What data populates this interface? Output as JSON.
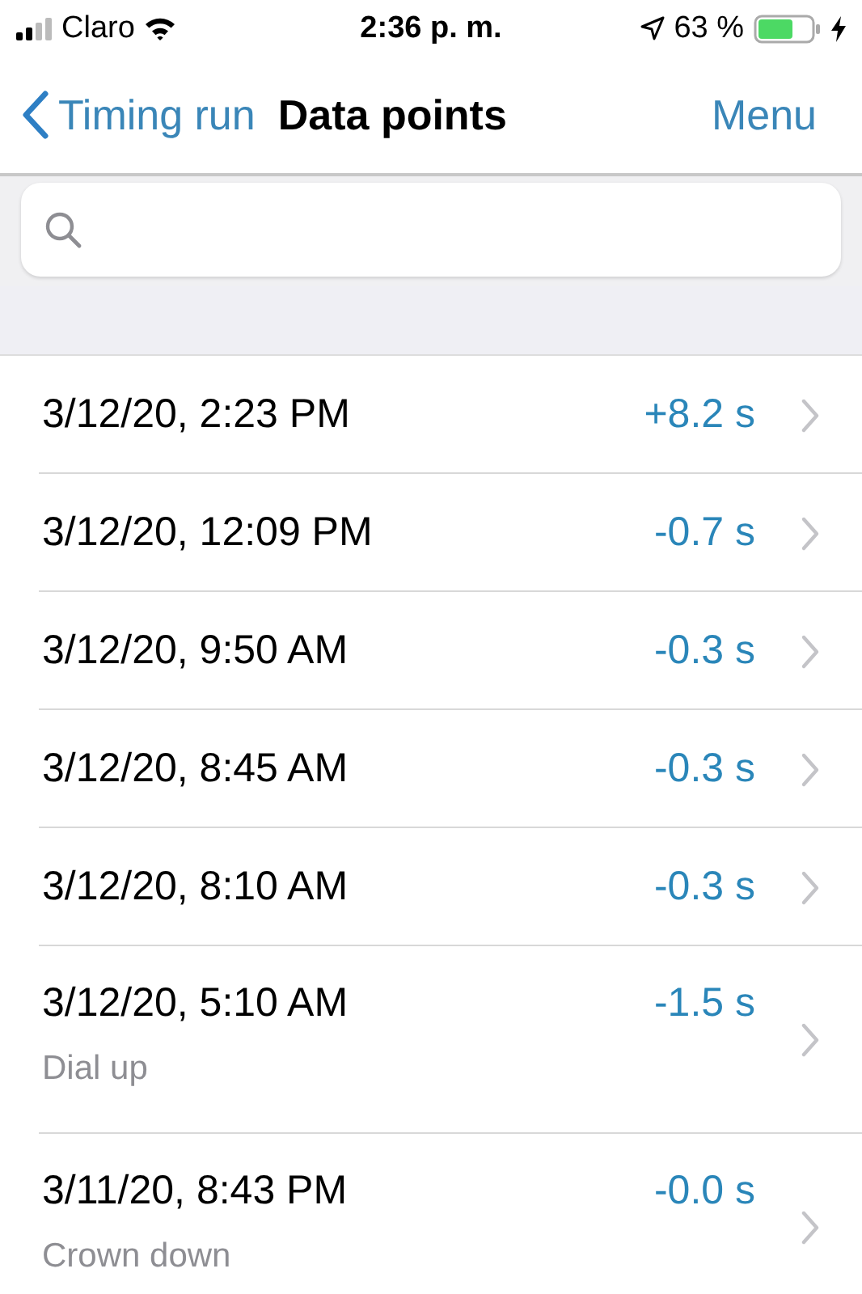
{
  "status_bar": {
    "carrier": "Claro",
    "time": "2:36 p. m.",
    "battery": "63 %"
  },
  "nav": {
    "back": "Timing run",
    "title": "Data points",
    "action": "Menu"
  },
  "rows": [
    {
      "date": "3/12/20, 2:23 PM",
      "value": "+8.2 s"
    },
    {
      "date": "3/12/20, 12:09 PM",
      "value": "-0.7 s"
    },
    {
      "date": "3/12/20, 9:50 AM",
      "value": "-0.3 s"
    },
    {
      "date": "3/12/20, 8:45 AM",
      "value": "-0.3 s"
    },
    {
      "date": "3/12/20, 8:10 AM",
      "value": "-0.3 s"
    },
    {
      "date": "3/12/20, 5:10 AM",
      "value": "-1.5 s",
      "note": "Dial up"
    },
    {
      "date": "3/11/20, 8:43 PM",
      "value": "-0.0 s",
      "note": "Crown down"
    }
  ]
}
